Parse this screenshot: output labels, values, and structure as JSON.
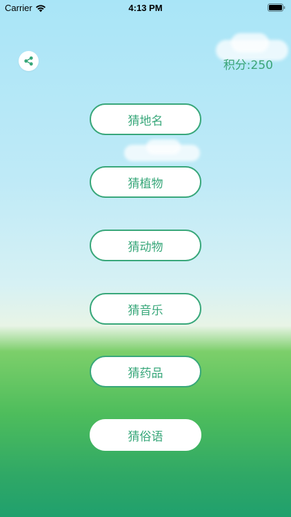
{
  "status_bar": {
    "carrier": "Carrier",
    "time": "4:13 PM",
    "icons": [
      "wifi-icon",
      "battery-icon"
    ]
  },
  "header": {
    "share_icon": "share-icon",
    "score": "积分:250"
  },
  "menu": {
    "items": [
      {
        "label": "猜地名"
      },
      {
        "label": "猜植物"
      },
      {
        "label": "猜动物"
      },
      {
        "label": "猜音乐"
      },
      {
        "label": "猜药品"
      },
      {
        "label": "猜俗语"
      }
    ]
  },
  "colors": {
    "accent": "#38a77a",
    "sky_top": "#a9e5f7",
    "grass": "#2fa866"
  }
}
